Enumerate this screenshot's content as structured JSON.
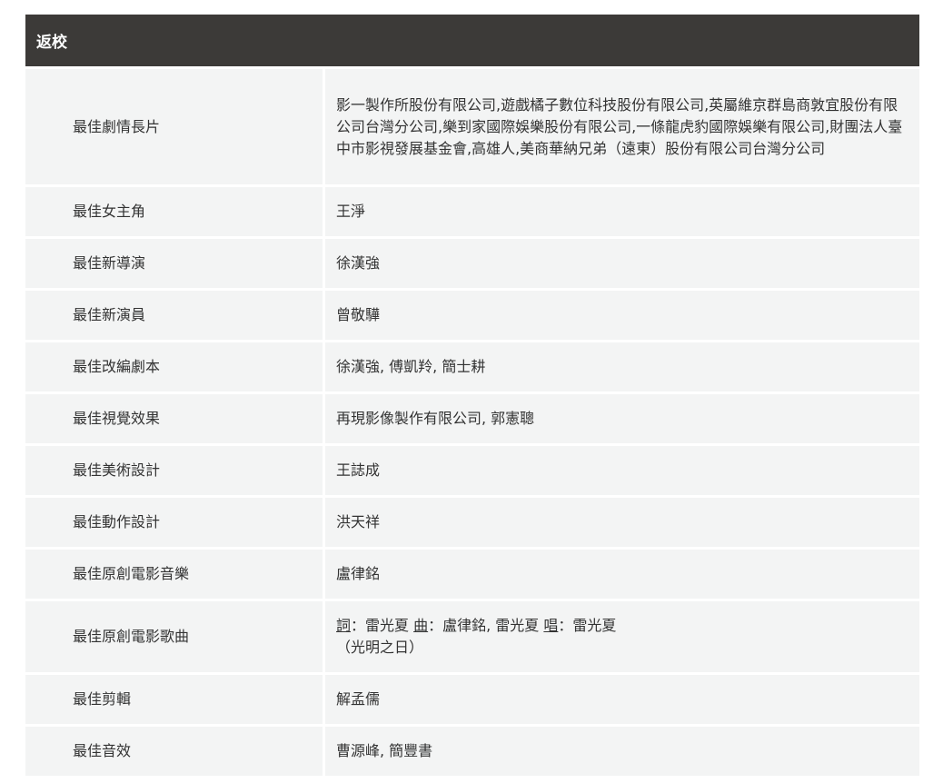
{
  "section": {
    "title": "返校"
  },
  "awards": [
    {
      "award": "最佳劇情長片",
      "winner": "影一製作所股份有限公司,遊戲橘子數位科技股份有限公司,英屬維京群島商敦宜股份有限公司台灣分公司,樂到家國際娛樂股份有限公司,一條龍虎豹國際娛樂有限公司,財團法人臺中市影視發展基金會,高雄人,美商華納兄弟（遠東）股份有限公司台灣分公司"
    },
    {
      "award": "最佳女主角",
      "winner": "王淨"
    },
    {
      "award": "最佳新導演",
      "winner": "徐漢強"
    },
    {
      "award": "最佳新演員",
      "winner": "曾敬驊"
    },
    {
      "award": "最佳改編劇本",
      "winner": "徐漢強, 傅凱羚, 簡士耕"
    },
    {
      "award": "最佳視覺效果",
      "winner": "再現影像製作有限公司, 郭憲聰"
    },
    {
      "award": "最佳美術設計",
      "winner": "王誌成"
    },
    {
      "award": "最佳動作設計",
      "winner": "洪天祥"
    },
    {
      "award": "最佳原創電影音樂",
      "winner": "盧律銘"
    },
    {
      "award": "最佳原創電影歌曲",
      "song": {
        "lyrics_label": "詞",
        "lyrics_sep": "：雷光夏 ",
        "music_label": "曲",
        "music_sep": "：盧律銘, 雷光夏 ",
        "vocal_label": "唱",
        "vocal_sep": "：雷光夏",
        "title": "（光明之日）"
      }
    },
    {
      "award": "最佳剪輯",
      "winner": "解孟儒"
    },
    {
      "award": "最佳音效",
      "winner": "曹源峰, 簡豐書"
    }
  ]
}
